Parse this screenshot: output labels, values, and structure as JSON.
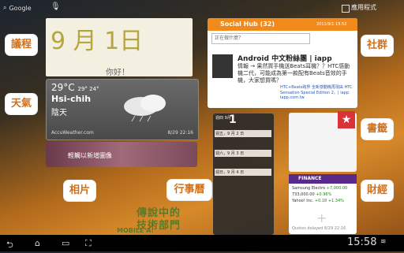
{
  "topbar": {
    "google": "Google",
    "apps": "應用程式"
  },
  "calendar": {
    "date": "9 月 1日",
    "greeting": "你好！"
  },
  "weather": {
    "temp": "29°C",
    "hilo": "29° 24°",
    "city": "Hsi-chih",
    "condition": "陰天",
    "source": "AccuWeather.com",
    "updated": "8/29 22:16"
  },
  "photo": {
    "label": "輕觸以新增圖像"
  },
  "social": {
    "title": "Social Hub (32)",
    "date": "2011/9/1 15:52",
    "input_placeholder": "正在做什麼？",
    "post_title": "Android 中文粉絲團 | iapp",
    "post_body": "情報 → 果然買手機送Beats耳機？？HTC感動機二代，可能成為第一款配有Beats音效的手機，大家想買嗎？",
    "link_title": "HTC+Beats跨界 全新感動機再現由 HTC Sensation Special Edition 2。| iapp",
    "link_url": "iapp.com.tw"
  },
  "agenda": {
    "header": "週四 9月",
    "day": "1",
    "rows": [
      "週五，9 月 2 日",
      "週六，9 月 3 日",
      "週日，9 月 4 日"
    ]
  },
  "finance": {
    "title": "FINANCE",
    "row1_name": "Samsung Electro",
    "row1_value": "733,000.00",
    "row1_change": "+7,000.00",
    "row1_pct": "+0.96%",
    "row2_name": "Yahoo! Inc.",
    "row2_change": "+0.18",
    "row2_pct": "+1.34%",
    "quotes": "Quotes delayed",
    "updated": "8/29 22:16"
  },
  "labels": {
    "calendar": "議程",
    "weather": "天氣",
    "photo": "相片",
    "agenda": "行事曆",
    "social": "社群",
    "bookmark": "書籤",
    "finance": "財經"
  },
  "logo": {
    "l1": "傳說中的",
    "l2": "技術部門",
    "l3": "MOBILE A!"
  },
  "nav": {
    "clock": "15:58"
  }
}
